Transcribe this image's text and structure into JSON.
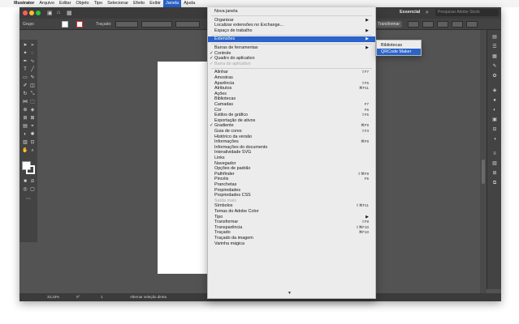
{
  "menubar": {
    "app_name": "Illustrator",
    "items": [
      "Arquivo",
      "Editar",
      "Objeto",
      "Tipo",
      "Selecionar",
      "Efeito",
      "Exibir",
      "Janela",
      "Ajuda"
    ],
    "active": "Janela"
  },
  "titlebar": {
    "workspace": "Essencial",
    "search_placeholder": "Pesquisar Adobe Stock"
  },
  "controlbar": {
    "group_label": "Grupo",
    "stroke_label": "Traçado:",
    "transform_label": "Transformar"
  },
  "statusbar": {
    "zoom": "33,33%",
    "rotation": "0°",
    "artboard": "1",
    "selection_tool": "Alternar seleção direta"
  },
  "janela_menu": {
    "items": [
      {
        "label": "Nova janela",
        "type": "item"
      },
      {
        "type": "sep"
      },
      {
        "label": "Organizar",
        "type": "submenu"
      },
      {
        "label": "Localizar extensões no Exchange...",
        "type": "item"
      },
      {
        "label": "Espaço de trabalho",
        "type": "submenu"
      },
      {
        "type": "sep"
      },
      {
        "label": "Extensões",
        "type": "submenu",
        "highlight": true
      },
      {
        "type": "sep"
      },
      {
        "label": "Barras de ferramentas",
        "type": "submenu"
      },
      {
        "label": "Controle",
        "type": "item",
        "checked": true
      },
      {
        "label": "Quadro do aplicativo",
        "type": "item",
        "checked": true
      },
      {
        "label": "Barra do aplicativo",
        "type": "item",
        "checked": true,
        "disabled": true
      },
      {
        "type": "sep"
      },
      {
        "label": "Alinhar",
        "type": "item",
        "shortcut": "⇧F7"
      },
      {
        "label": "Amostras",
        "type": "item"
      },
      {
        "label": "Aparência",
        "type": "item",
        "shortcut": "⇧F6"
      },
      {
        "label": "Atributos",
        "type": "item",
        "shortcut": "⌘F11"
      },
      {
        "label": "Ações",
        "type": "item"
      },
      {
        "label": "Bibliotecas",
        "type": "item"
      },
      {
        "label": "Camadas",
        "type": "item",
        "shortcut": "F7"
      },
      {
        "label": "Cor",
        "type": "item",
        "shortcut": "F6"
      },
      {
        "label": "Estilos de gráfico",
        "type": "item",
        "shortcut": "⇧F5"
      },
      {
        "label": "Exportação de ativos",
        "type": "item"
      },
      {
        "label": "Gradiente",
        "type": "item",
        "checked": true,
        "shortcut": "⌘F9"
      },
      {
        "label": "Guia de cores",
        "type": "item",
        "shortcut": "⇧F3"
      },
      {
        "label": "Histórico da versão",
        "type": "item"
      },
      {
        "label": "Informações",
        "type": "item",
        "shortcut": "⌘F8"
      },
      {
        "label": "Informações do documento",
        "type": "item"
      },
      {
        "label": "Interatividade SVG",
        "type": "item"
      },
      {
        "label": "Links",
        "type": "item"
      },
      {
        "label": "Navegador",
        "type": "item"
      },
      {
        "label": "Opções de padrão",
        "type": "item"
      },
      {
        "label": "Pathfinder",
        "type": "item",
        "shortcut": "⇧⌘F9"
      },
      {
        "label": "Pincéis",
        "type": "item",
        "shortcut": "F5"
      },
      {
        "label": "Pranchetas",
        "type": "item"
      },
      {
        "label": "Propriedades",
        "type": "item"
      },
      {
        "label": "Propriedades CSS",
        "type": "item"
      },
      {
        "label": "Saída mais",
        "type": "item",
        "disabled": true
      },
      {
        "label": "Símbolos",
        "type": "item",
        "shortcut": "⇧⌘F11"
      },
      {
        "label": "Temas do Adobe Color",
        "type": "item"
      },
      {
        "label": "Tipo",
        "type": "submenu"
      },
      {
        "label": "Transformar",
        "type": "item",
        "shortcut": "⇧F8"
      },
      {
        "label": "Transparência",
        "type": "item",
        "shortcut": "⇧⌘F10"
      },
      {
        "label": "Traçado",
        "type": "item",
        "shortcut": "⌘F10"
      },
      {
        "label": "Traçado da imagem",
        "type": "item"
      },
      {
        "label": "Varinha mágica",
        "type": "item"
      }
    ],
    "more_indicator": "▼"
  },
  "extensoes_submenu": {
    "items": [
      {
        "label": "Bibliotecas"
      },
      {
        "label": "QRCode Maker",
        "highlight": true
      }
    ]
  }
}
